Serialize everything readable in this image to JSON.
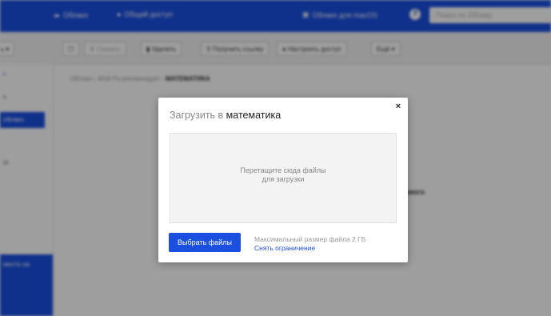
{
  "topbar": {
    "brand": "Облако",
    "shared": "Общий доступ",
    "mac_app": "Облако для macOS",
    "help": "?",
    "search_placeholder": "Поиск по Облаку"
  },
  "toolbar": {
    "dropdown": "ь ▾",
    "checkbox": "☐",
    "download": "Скачать",
    "delete": "Удалить",
    "get_link": "Получить ссылку",
    "configure_access": "Настроить доступ",
    "more": "Ещё ▾"
  },
  "sidebar": {
    "top_item": "•",
    "item_two": "ь",
    "active_item": "облако",
    "item_four": "ш",
    "promo_text": "место на"
  },
  "breadcrumbs": {
    "home": "Облако",
    "folder": "Мой Ps pекомендует",
    "current": "МАТЕМАТИКА"
  },
  "main": {
    "partial_text": "емого"
  },
  "modal": {
    "title_prefix": "Загрузить в",
    "title_folder": "математика",
    "close": "×",
    "drop_hint_line1": "Перетащите сюда файлы",
    "drop_hint_line2": "для загрузки",
    "choose_button": "Выбрать файлы",
    "max_size": "Максимальный размер файла 2 ГБ",
    "remove_limit": "Снять ограничение"
  }
}
